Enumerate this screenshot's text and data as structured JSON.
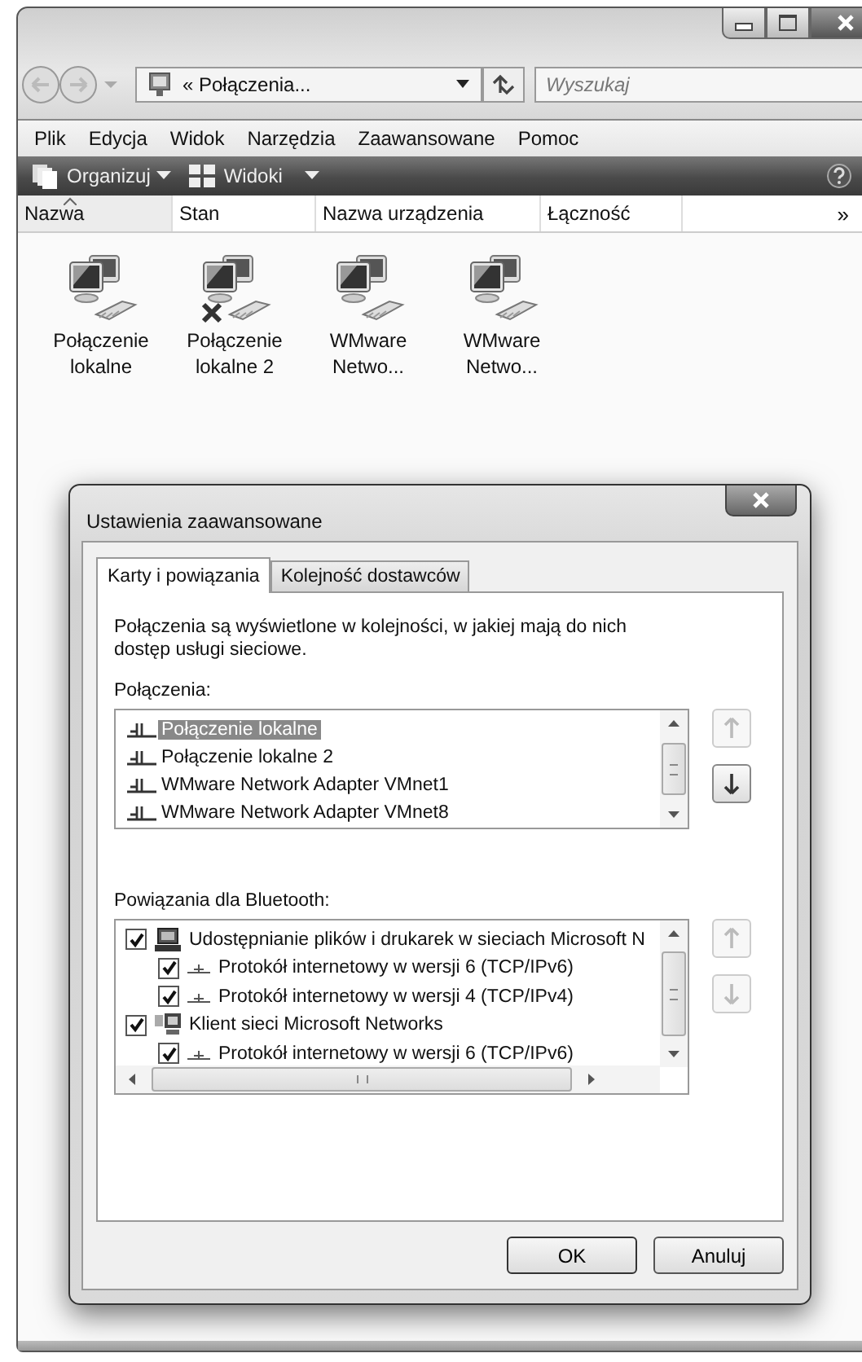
{
  "window": {
    "address": "« Połączenia...",
    "search_placeholder": "Wyszukaj"
  },
  "menu": [
    "Plik",
    "Edycja",
    "Widok",
    "Narzędzia",
    "Zaawansowane",
    "Pomoc"
  ],
  "toolbar": [
    {
      "label": "Organizuj",
      "kind": "organize"
    },
    {
      "label": "Widoki",
      "kind": "views"
    }
  ],
  "columns": [
    {
      "label": "Nazwa",
      "sorted": true
    },
    {
      "label": "Stan",
      "sorted": false
    },
    {
      "label": "Nazwa urządzenia",
      "sorted": false
    },
    {
      "label": "Łączność",
      "sorted": false
    }
  ],
  "columns_more": "»",
  "items": [
    {
      "label": "Połączenie lokalne",
      "disconnected": false
    },
    {
      "label": "Połączenie lokalne 2",
      "disconnected": true
    },
    {
      "label": "WMware Netwo...",
      "disconnected": false
    },
    {
      "label": "WMware Netwo...",
      "disconnected": false
    }
  ],
  "dialog": {
    "title": "Ustawienia zaawansowane",
    "tabs": [
      {
        "label": "Karty i powiązania",
        "selected": true
      },
      {
        "label": "Kolejność dostawców",
        "selected": false
      }
    ],
    "description": "Połączenia są wyświetlone w kolejności, w jakiej mają do nich dostęp usługi sieciowe.",
    "connections_label": "Połączenia:",
    "connections": [
      {
        "label": "Połączenie lokalne",
        "selected": true
      },
      {
        "label": "Połączenie lokalne 2",
        "selected": false
      },
      {
        "label": "WMware Network Adapter VMnet1",
        "selected": false
      },
      {
        "label": "WMware Network Adapter VMnet8",
        "selected": false
      }
    ],
    "connections_up_disabled": true,
    "connections_down_disabled": false,
    "bindings_label": "Powiązania dla Bluetooth:",
    "bindings": [
      {
        "label": "Udostępnianie plików i drukarek w sieciach Microsoft N",
        "checked": true,
        "kind": "sharing",
        "children": [
          {
            "label": "Protokół internetowy w wersji 6 (TCP/IPv6)",
            "checked": true,
            "kind": "protocol"
          },
          {
            "label": "Protokół internetowy w wersji 4 (TCP/IPv4)",
            "checked": true,
            "kind": "protocol"
          }
        ]
      },
      {
        "label": "Klient sieci Microsoft Networks",
        "checked": true,
        "kind": "client",
        "children": [
          {
            "label": "Protokół internetowy w wersji 6 (TCP/IPv6)",
            "checked": true,
            "kind": "protocol"
          }
        ]
      }
    ],
    "bindings_up_disabled": true,
    "bindings_down_disabled": true,
    "buttons": [
      "OK",
      "Anuluj"
    ]
  }
}
